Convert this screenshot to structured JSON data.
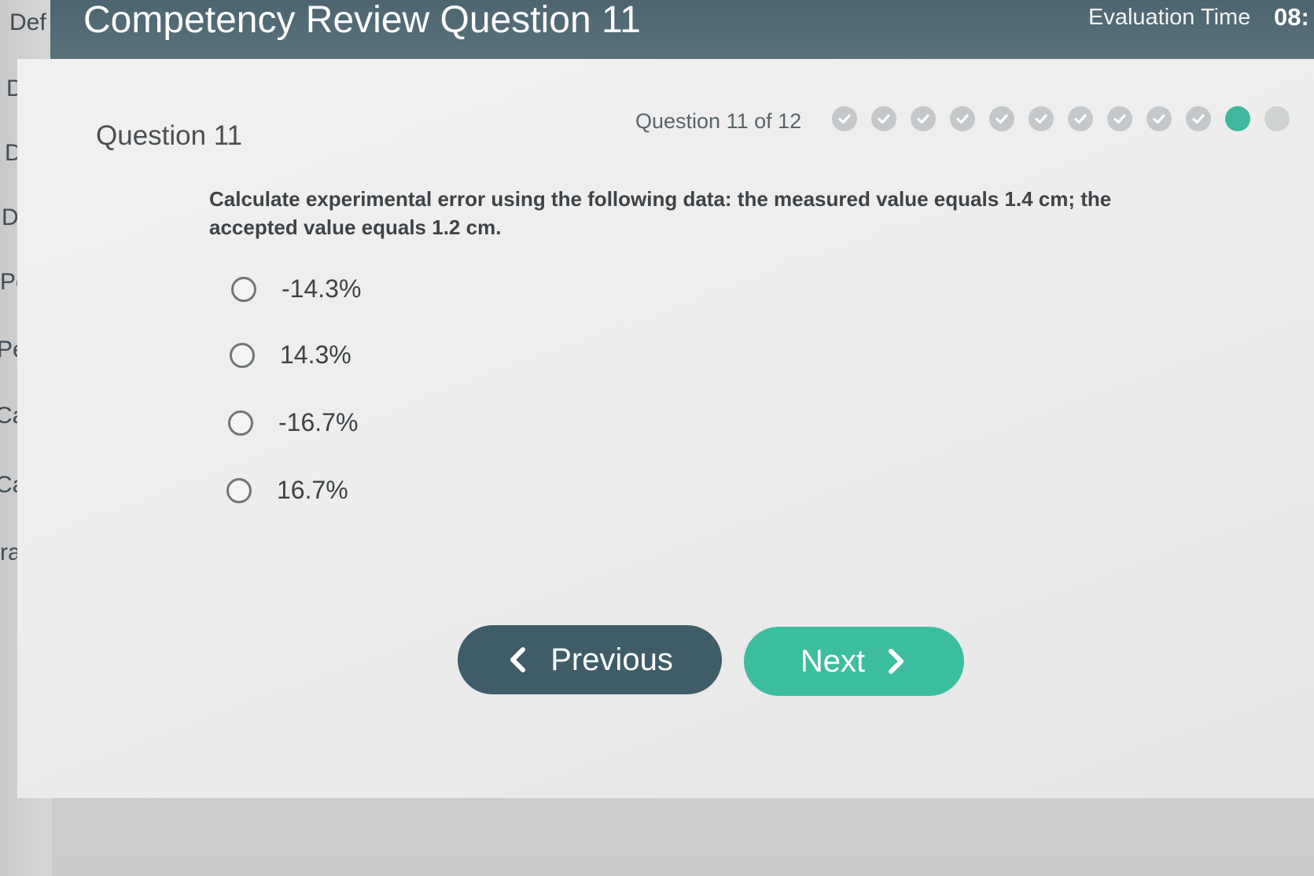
{
  "sidebar": {
    "items": [
      {
        "label": "Def"
      },
      {
        "label": "Def"
      },
      {
        "label": "Def"
      },
      {
        "label": "Def"
      },
      {
        "label": "Per"
      },
      {
        "label": "Per"
      },
      {
        "label": "Calc"
      },
      {
        "label": "Calc"
      },
      {
        "label": "ra"
      }
    ]
  },
  "header": {
    "title": "Competency Review Question 11",
    "eval_label": "Evaluation Time",
    "eval_time": "08:"
  },
  "question": {
    "heading": "Question 11",
    "progress_text": "Question 11 of 12",
    "current": 11,
    "total": 12,
    "prompt": "Calculate experimental error using the following data: the measured value equals 1.4 cm; the accepted value equals 1.2 cm.",
    "options": [
      {
        "label": "-14.3%"
      },
      {
        "label": "14.3%"
      },
      {
        "label": "-16.7%"
      },
      {
        "label": "16.7%"
      }
    ]
  },
  "nav": {
    "previous_label": "Previous",
    "next_label": "Next"
  },
  "colors": {
    "header_bg": "#4c6570",
    "accent": "#3dbd9f",
    "previous_bg": "#3f5d69",
    "completed_dot": "#c4c8ca"
  },
  "icons": {
    "completed_dot": "check-icon",
    "previous": "chevron-left-icon",
    "next": "chevron-right-icon"
  }
}
